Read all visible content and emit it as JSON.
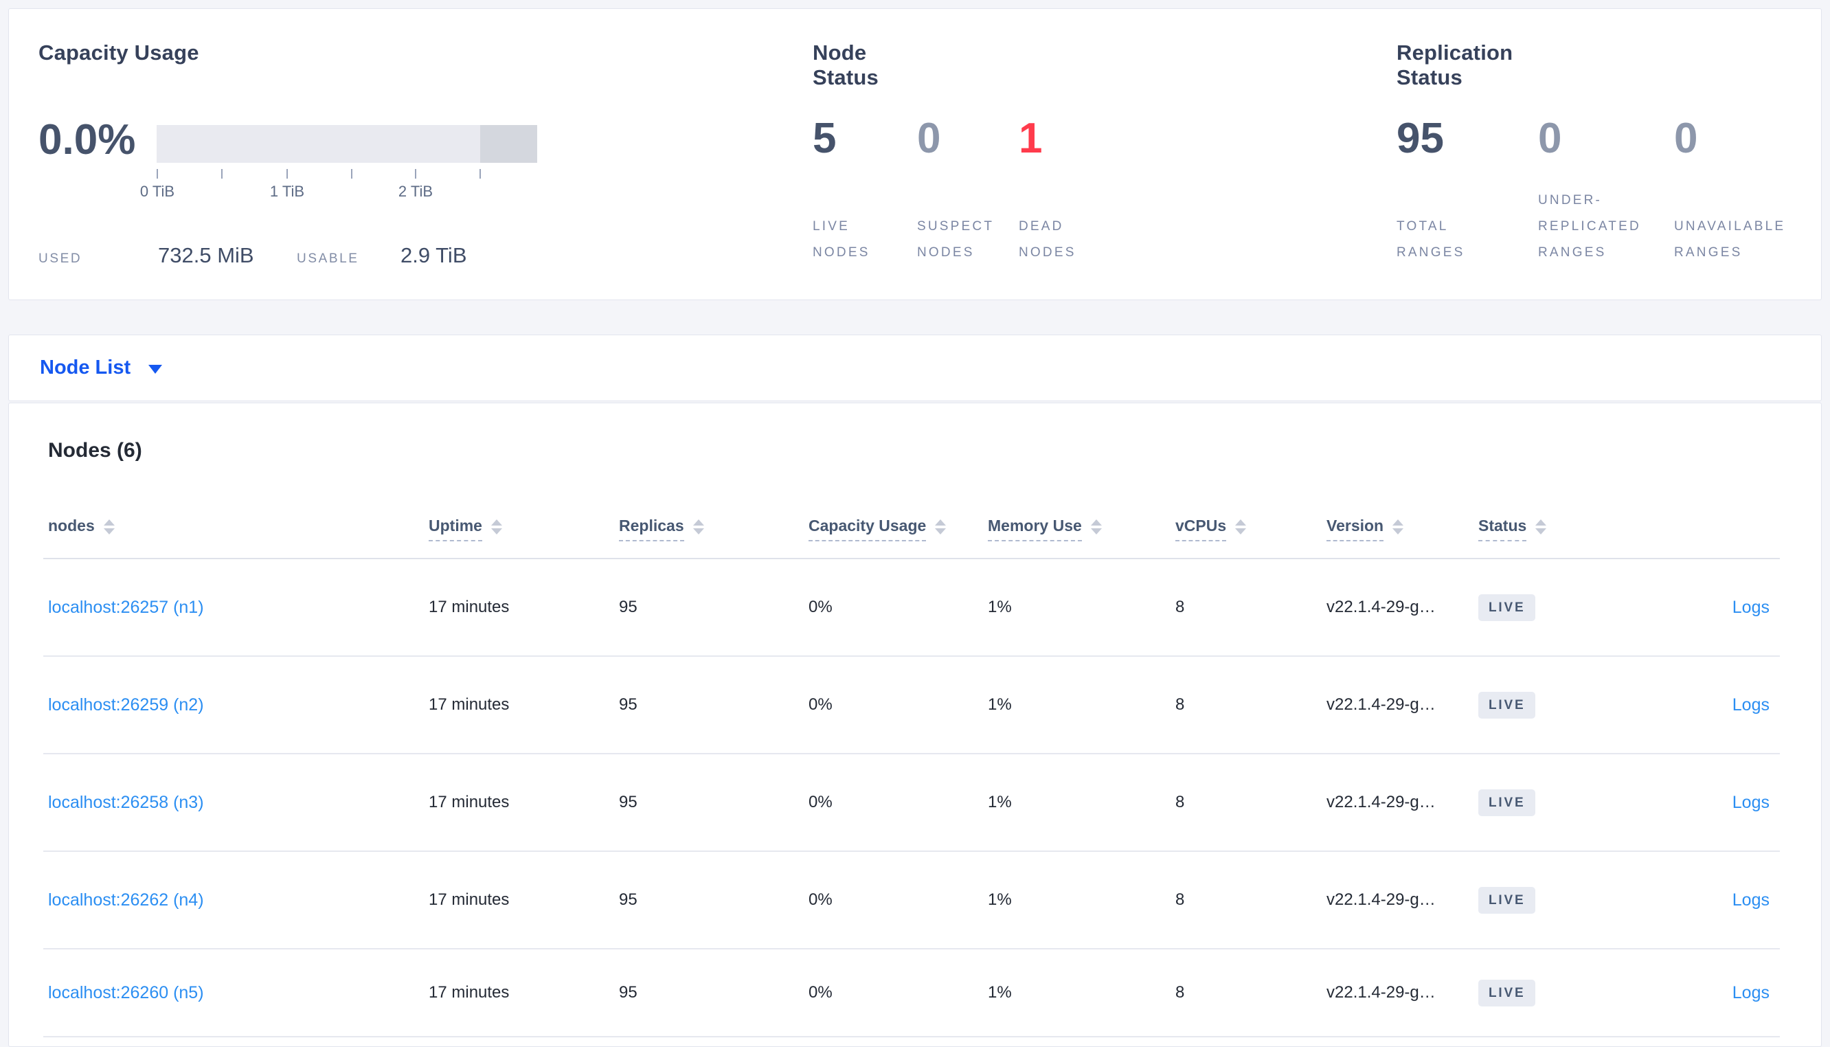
{
  "summary": {
    "capacity": {
      "title": "Capacity Usage",
      "percent": "0.0%",
      "tick_labels": [
        "0 TiB",
        "1 TiB",
        "2 TiB"
      ],
      "used_label": "USED",
      "used_value": "732.5 MiB",
      "usable_label": "USABLE",
      "usable_value": "2.9 TiB"
    },
    "node_status": {
      "title": "Node Status",
      "stats": [
        {
          "value": "5",
          "label": "LIVE\nNODES",
          "state": "dark"
        },
        {
          "value": "0",
          "label": "SUSPECT\nNODES",
          "state": "light"
        },
        {
          "value": "1",
          "label": "DEAD\nNODES",
          "state": "red"
        }
      ]
    },
    "replication": {
      "title": "Replication Status",
      "stats": [
        {
          "value": "95",
          "label": "TOTAL\nRANGES",
          "state": "dark"
        },
        {
          "value": "0",
          "label": "UNDER-\nREPLICATED\nRANGES",
          "state": "light"
        },
        {
          "value": "0",
          "label": "UNAVAILABLE\nRANGES",
          "state": "light"
        }
      ]
    }
  },
  "view_switcher": {
    "label": "Node List"
  },
  "table": {
    "title": "Nodes (6)",
    "columns": [
      {
        "label": "nodes"
      },
      {
        "label": "Uptime"
      },
      {
        "label": "Replicas"
      },
      {
        "label": "Capacity Usage"
      },
      {
        "label": "Memory Use"
      },
      {
        "label": "vCPUs"
      },
      {
        "label": "Version"
      },
      {
        "label": "Status"
      }
    ],
    "rows": [
      {
        "node": "localhost:26257 (n1)",
        "uptime": "17 minutes",
        "replicas": "95",
        "capacity_usage": "0%",
        "memory_use": "1%",
        "vcpus": "8",
        "version": "v22.1.4-29-g…",
        "status": "LIVE",
        "logs": "Logs"
      },
      {
        "node": "localhost:26259 (n2)",
        "uptime": "17 minutes",
        "replicas": "95",
        "capacity_usage": "0%",
        "memory_use": "1%",
        "vcpus": "8",
        "version": "v22.1.4-29-g…",
        "status": "LIVE",
        "logs": "Logs"
      },
      {
        "node": "localhost:26258 (n3)",
        "uptime": "17 minutes",
        "replicas": "95",
        "capacity_usage": "0%",
        "memory_use": "1%",
        "vcpus": "8",
        "version": "v22.1.4-29-g…",
        "status": "LIVE",
        "logs": "Logs"
      },
      {
        "node": "localhost:26262 (n4)",
        "uptime": "17 minutes",
        "replicas": "95",
        "capacity_usage": "0%",
        "memory_use": "1%",
        "vcpus": "8",
        "version": "v22.1.4-29-g…",
        "status": "LIVE",
        "logs": "Logs"
      },
      {
        "node": "localhost:26260 (n5)",
        "uptime": "17 minutes",
        "replicas": "95",
        "capacity_usage": "0%",
        "memory_use": "1%",
        "vcpus": "8",
        "version": "v22.1.4-29-g…",
        "status": "LIVE",
        "logs": "Logs"
      }
    ]
  },
  "colors": {
    "page_background": "#f4f5f9",
    "card_border": "#e2e5ee",
    "stat_dark": "#46536b",
    "stat_light": "#8d97ab",
    "stat_dead_red": "#ff3b4c",
    "label_slate": "#7b86a3",
    "switcher_blue": "#1558f0",
    "link_blue": "#2b8ef2",
    "badge_background": "#e8ebf2",
    "badge_text": "#475872",
    "bar_fill": "#e9eaf0",
    "bar_tail": "#d4d7de"
  }
}
